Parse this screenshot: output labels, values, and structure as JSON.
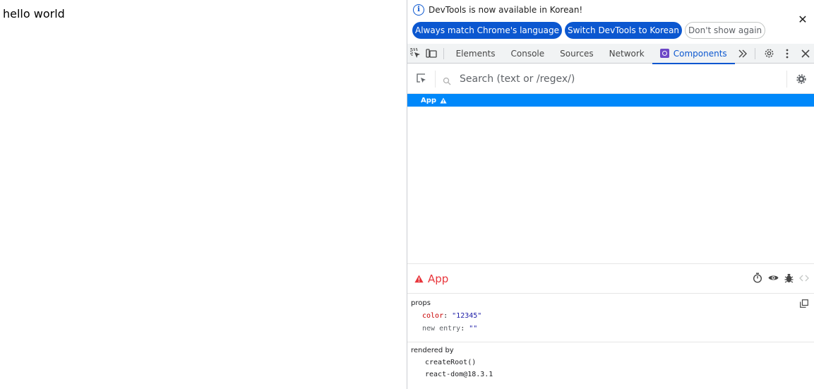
{
  "page": {
    "text": "hello world"
  },
  "infobar": {
    "message": "DevTools is now available in Korean!",
    "buttons": {
      "match_language": "Always match Chrome's language",
      "switch_korean": "Switch DevTools to Korean",
      "dont_show": "Don't show again"
    }
  },
  "tabs": [
    {
      "label": "Elements"
    },
    {
      "label": "Console"
    },
    {
      "label": "Sources"
    },
    {
      "label": "Network"
    },
    {
      "label": "Components"
    }
  ],
  "search": {
    "placeholder": "Search (text or /regex/)"
  },
  "tree": {
    "selected_component": "App"
  },
  "detail": {
    "title": "App",
    "props_label": "props",
    "props": [
      {
        "key": "color",
        "value": "\"12345\""
      },
      {
        "key": "new entry",
        "value": "\"\""
      }
    ],
    "rendered_by_label": "rendered by",
    "rendered_by": [
      "createRoot()",
      "react-dom@18.3.1"
    ]
  },
  "colors": {
    "accent": "#0b57d0",
    "selection": "#0088fa",
    "warning": "#e8363c",
    "react": "#6d48c7"
  }
}
